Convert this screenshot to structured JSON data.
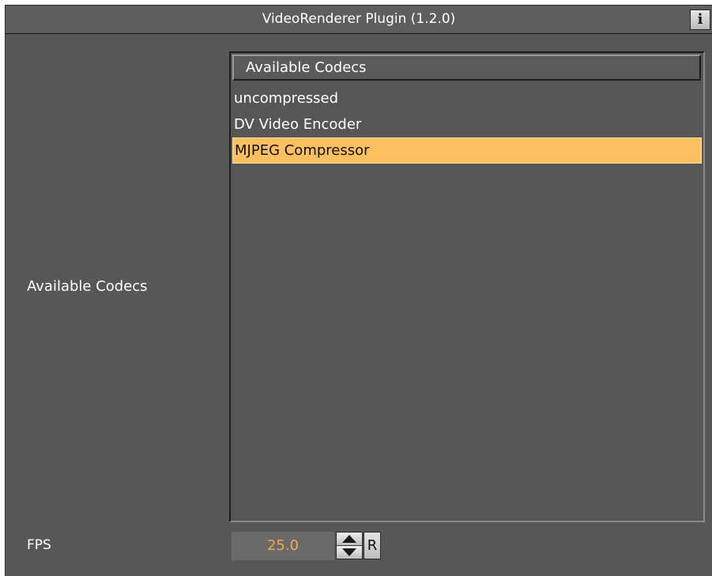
{
  "window": {
    "title": "VideoRenderer Plugin (1.2.0)",
    "info_button": "i"
  },
  "codecs": {
    "label": "Available Codecs",
    "list_header": "Available Codecs",
    "items": [
      {
        "label": "uncompressed",
        "selected": false
      },
      {
        "label": "DV Video Encoder",
        "selected": false
      },
      {
        "label": "MJPEG Compressor",
        "selected": true
      }
    ]
  },
  "fps": {
    "label": "FPS",
    "value": "25.0",
    "reset_label": "R"
  },
  "colors": {
    "panel_bg": "#575757",
    "selection": "#fdc060",
    "value_text": "#f2a848"
  },
  "icons": {
    "info": "info-icon",
    "spin_up": "arrow-up-icon",
    "spin_down": "arrow-down-icon"
  }
}
